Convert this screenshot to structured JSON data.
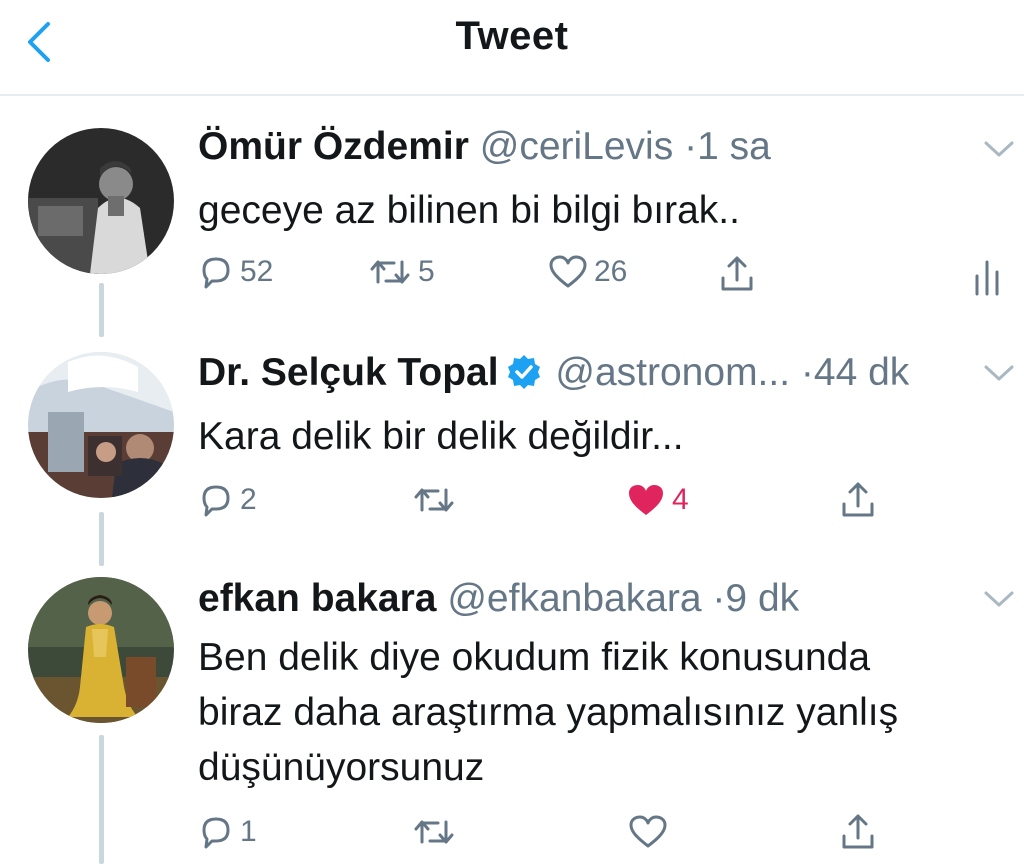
{
  "header": {
    "title": "Tweet"
  },
  "tweets": [
    {
      "name": "Ömür Özdemir",
      "handle": "@ceriLevis",
      "separator": "·",
      "time": "1 sa",
      "text": "geceye az bilinen bi bilgi bırak..",
      "replies": "52",
      "retweets": "5",
      "likes": "26",
      "liked": false
    },
    {
      "name": "Dr. Selçuk Topal",
      "verified": true,
      "handle": "@astronom...",
      "separator": "·",
      "time": "44 dk",
      "text": "Kara delik bir delik değildir...",
      "replies": "2",
      "retweets": "",
      "likes": "4",
      "liked": true
    },
    {
      "name": "efkan bakara",
      "handle": "@efkanbakara",
      "separator": "·",
      "time": "9 dk",
      "text_lines": [
        "Ben delik diye okudum fizik konusunda",
        "biraz daha araştırma yapmalısınız yanlış",
        "düşünüyorsunuz"
      ],
      "replies": "1",
      "retweets": "",
      "likes": "",
      "liked": false
    }
  ],
  "colors": {
    "accent": "#1da1f2",
    "like_red": "#e0245e",
    "secondary_text": "#657786",
    "thread_line": "#ccd6dd"
  },
  "icons": [
    "back-chevron-icon",
    "reply-icon",
    "retweet-icon",
    "heart-icon",
    "share-icon",
    "analytics-icon",
    "caret-down-icon",
    "verified-badge-icon"
  ]
}
